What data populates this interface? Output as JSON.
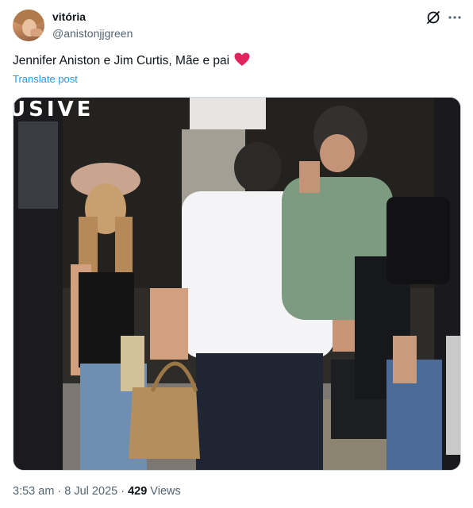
{
  "user": {
    "display_name": "vitória",
    "handle": "@anistonjjgreen"
  },
  "icons": {
    "avatar": "profile-photo",
    "grok": "grok-icon",
    "more": "more-dots-icon",
    "heart": "red-heart-emoji"
  },
  "post": {
    "text": "Jennifer Aniston e Jim Curtis, Mãe e pai",
    "translate_label": "Translate post",
    "media_caption": "USIVE",
    "timestamp": "3:53 am · 8 Jul 2025 · ",
    "views_count": "429",
    "views_label": " Views"
  },
  "colors": {
    "link": "#1d9bf0",
    "secondary_text": "#536471",
    "heart": "#e0245e"
  }
}
